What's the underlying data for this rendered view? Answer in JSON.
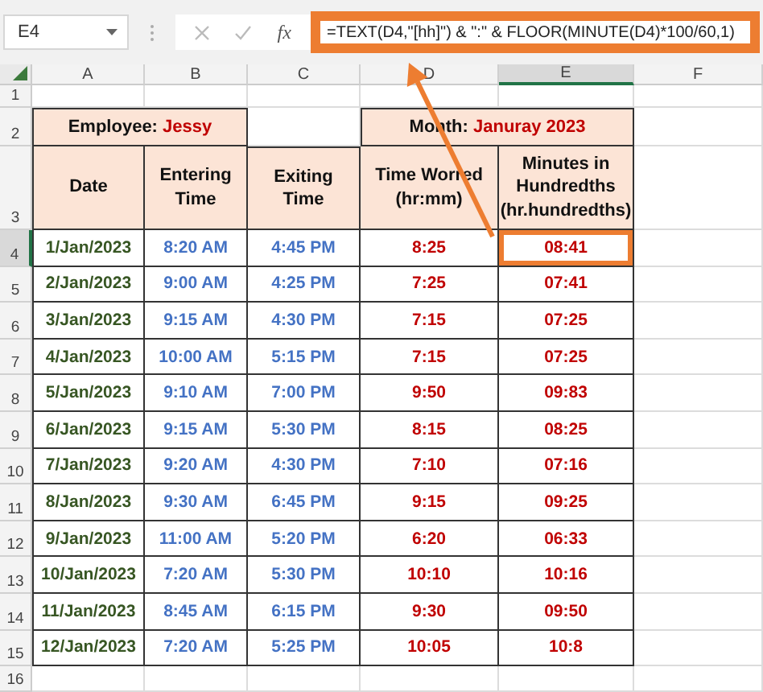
{
  "name_box": "E4",
  "formula_bar": {
    "function_label": "fx",
    "formula": "=TEXT(D4,\"[hh]\") & \":\" & FLOOR(MINUTE(D4)*100/60,1)",
    "highlighted": true
  },
  "columns": [
    {
      "label": "A",
      "selected": false
    },
    {
      "label": "B",
      "selected": false
    },
    {
      "label": "C",
      "selected": false
    },
    {
      "label": "D",
      "selected": false
    },
    {
      "label": "E",
      "selected": true
    },
    {
      "label": "F",
      "selected": false
    }
  ],
  "row_numbers": [
    {
      "label": "1",
      "selected": false
    },
    {
      "label": "2",
      "selected": false
    },
    {
      "label": "3",
      "selected": false
    },
    {
      "label": "4",
      "selected": true
    },
    {
      "label": "5",
      "selected": false
    },
    {
      "label": "6",
      "selected": false
    },
    {
      "label": "7",
      "selected": false
    },
    {
      "label": "8",
      "selected": false
    },
    {
      "label": "9",
      "selected": false
    },
    {
      "label": "10",
      "selected": false
    },
    {
      "label": "11",
      "selected": false
    },
    {
      "label": "12",
      "selected": false
    },
    {
      "label": "13",
      "selected": false
    },
    {
      "label": "14",
      "selected": false
    },
    {
      "label": "15",
      "selected": false
    },
    {
      "label": "16",
      "selected": false
    }
  ],
  "table": {
    "employee": {
      "label": "Employee:",
      "value": "Jessy"
    },
    "month": {
      "label": "Month:",
      "value": "Januray 2023"
    },
    "headers": [
      "Date",
      "Entering Time",
      "Exiting Time",
      "Time Worred (hr:mm)",
      "Minutes in Hundredths (hr.hundredths)"
    ],
    "rows": [
      {
        "date": "1/Jan/2023",
        "entering": "8:20 AM",
        "exiting": "4:45 PM",
        "worked": "8:25",
        "hundredths": "08:41",
        "highlighted": true
      },
      {
        "date": "2/Jan/2023",
        "entering": "9:00 AM",
        "exiting": "4:25 PM",
        "worked": "7:25",
        "hundredths": "07:41",
        "highlighted": false
      },
      {
        "date": "3/Jan/2023",
        "entering": "9:15 AM",
        "exiting": "4:30 PM",
        "worked": "7:15",
        "hundredths": "07:25",
        "highlighted": false
      },
      {
        "date": "4/Jan/2023",
        "entering": "10:00 AM",
        "exiting": "5:15 PM",
        "worked": "7:15",
        "hundredths": "07:25",
        "highlighted": false
      },
      {
        "date": "5/Jan/2023",
        "entering": "9:10 AM",
        "exiting": "7:00 PM",
        "worked": "9:50",
        "hundredths": "09:83",
        "highlighted": false
      },
      {
        "date": "6/Jan/2023",
        "entering": "9:15 AM",
        "exiting": "5:30 PM",
        "worked": "8:15",
        "hundredths": "08:25",
        "highlighted": false
      },
      {
        "date": "7/Jan/2023",
        "entering": "9:20 AM",
        "exiting": "4:30 PM",
        "worked": "7:10",
        "hundredths": "07:16",
        "highlighted": false
      },
      {
        "date": "8/Jan/2023",
        "entering": "9:30 AM",
        "exiting": "6:45 PM",
        "worked": "9:15",
        "hundredths": "09:25",
        "highlighted": false
      },
      {
        "date": "9/Jan/2023",
        "entering": "11:00 AM",
        "exiting": "5:20 PM",
        "worked": "6:20",
        "hundredths": "06:33",
        "highlighted": false
      },
      {
        "date": "10/Jan/2023",
        "entering": "7:20 AM",
        "exiting": "5:30 PM",
        "worked": "10:10",
        "hundredths": "10:16",
        "highlighted": false
      },
      {
        "date": "11/Jan/2023",
        "entering": "8:45 AM",
        "exiting": "6:15 PM",
        "worked": "9:30",
        "hundredths": "09:50",
        "highlighted": false
      },
      {
        "date": "12/Jan/2023",
        "entering": "7:20 AM",
        "exiting": "5:25 PM",
        "worked": "10:05",
        "hundredths": "10:8",
        "highlighted": false
      }
    ]
  }
}
